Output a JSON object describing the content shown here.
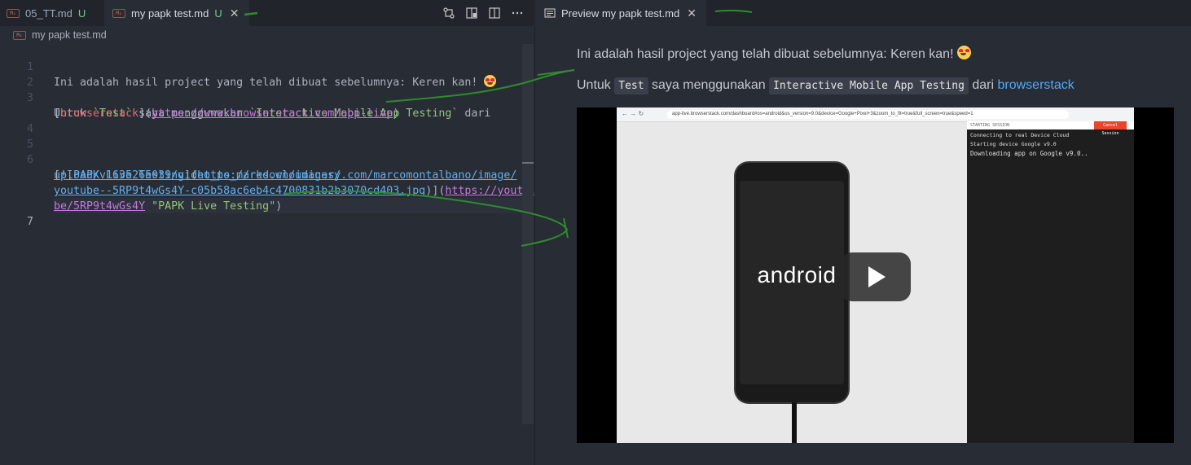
{
  "left_tabs": [
    {
      "icon": "M↓",
      "label": "05_TT.md",
      "status": "U"
    },
    {
      "icon": "M↓",
      "label": "my papk test.md",
      "status": "U",
      "close": "✕"
    }
  ],
  "right_tab": {
    "label": "Preview my papk test.md",
    "close": "✕"
  },
  "breadcrumb": "my papk test.md",
  "editor": {
    "line_numbers": [
      "1",
      "2",
      "3",
      "4",
      "5",
      "6",
      "7"
    ],
    "line1": "Ini adalah hasil project yang telah dibuat sebelumnya: Keren kan! ",
    "line3": {
      "a": "Untuk ",
      "b": "`Test`",
      "c": " saya menggunakan ",
      "d": "`Interactive Mobile App Testing`",
      "e": " dari"
    },
    "line3b": {
      "a": "[",
      "b": "browserstack",
      "c": "](",
      "d": "https://www.browserstack.com/app-live",
      "e": ")"
    },
    "line6": {
      "a": "[![",
      "b": "PAPK Live Testing",
      "c": "](",
      "d": "https://res.cloudinary.com/marcomontalbano/image/",
      "e": "upload/v1635265039/video_to_markdown/images/",
      "f": "youtube--5RP9t4wGs4Y-c05b58ac6eb4c4700831b2b3070cd403.jpg",
      "g": ")](",
      "h": "https://youtu.",
      "i": "be/5RP9t4wGs4Y",
      "j": " ",
      "k": "\"PAPK Live Testing\"",
      "l": ")"
    }
  },
  "preview": {
    "line1": "Ini adalah hasil project yang telah dibuat sebelumnya: Keren kan! ",
    "line2": {
      "a": "Untuk ",
      "code1": "Test",
      "b": " saya menggunakan ",
      "code2": "Interactive Mobile App Testing",
      "c": " dari ",
      "link": "browserstack"
    }
  },
  "video": {
    "url": "app-live.browserstack.com/dashboard#os=android&os_version=9.0&device=Google+Pixel+3&zoom_to_fit=true&full_screen=true&speed=1",
    "panel_title": "STARTING SESSION",
    "cancel": "Cancel Session",
    "logs": [
      "Connecting to real Device Cloud",
      "Starting device Google v9.0",
      "Downloading app on Google v9.0.."
    ],
    "android_label": "android"
  },
  "colors": {
    "accent_link": "#4daafc",
    "untracked": "#73c991",
    "annotation": "#2e8b2e"
  }
}
